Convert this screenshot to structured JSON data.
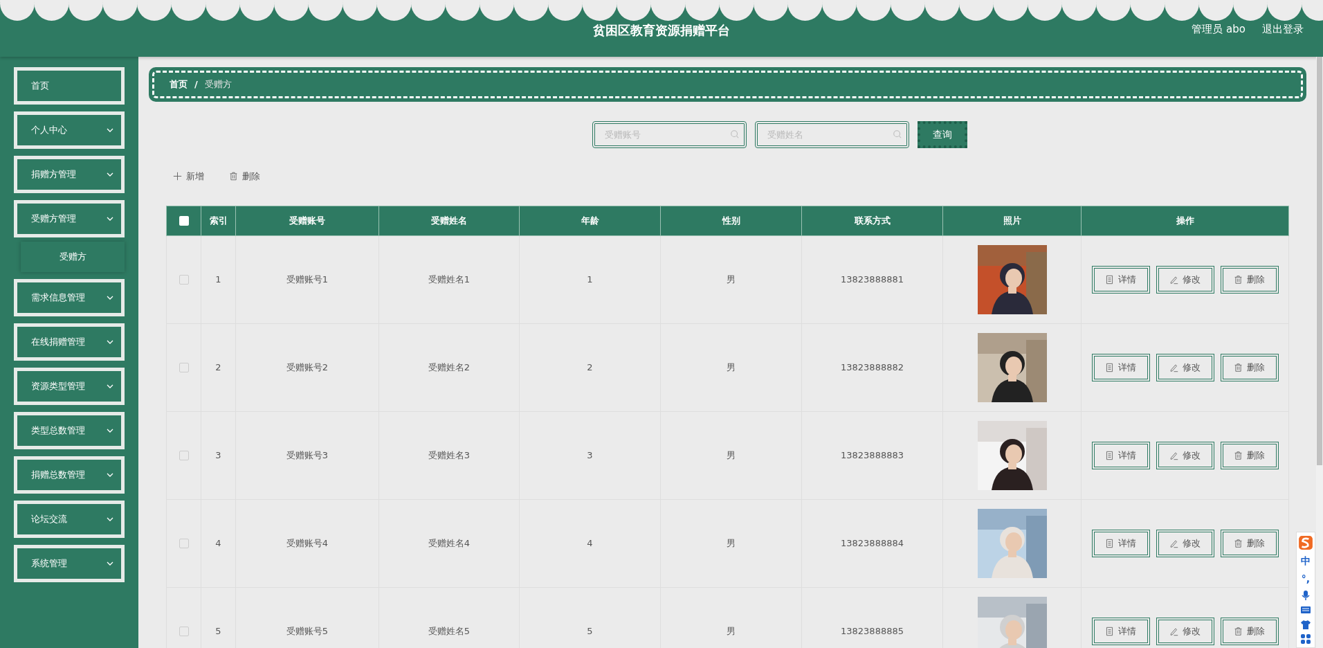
{
  "header": {
    "title": "贫困区教育资源捐赠平台",
    "user": "管理员 abo",
    "logout": "退出登录"
  },
  "sidebar": {
    "items": [
      {
        "label": "首页",
        "kind": "link"
      },
      {
        "label": "个人中心",
        "kind": "menu"
      },
      {
        "label": "捐赠方管理",
        "kind": "menu"
      },
      {
        "label": "受赠方管理",
        "kind": "menu",
        "children": [
          {
            "label": "受赠方"
          }
        ]
      },
      {
        "label": "需求信息管理",
        "kind": "menu"
      },
      {
        "label": "在线捐赠管理",
        "kind": "menu"
      },
      {
        "label": "资源类型管理",
        "kind": "menu"
      },
      {
        "label": "类型总数管理",
        "kind": "menu"
      },
      {
        "label": "捐赠总数管理",
        "kind": "menu"
      },
      {
        "label": "论坛交流",
        "kind": "menu"
      },
      {
        "label": "系统管理",
        "kind": "menu"
      }
    ]
  },
  "breadcrumb_separator": "/",
  "breadcrumb": [
    {
      "label": "首页",
      "current": false
    },
    {
      "label": "受赠方",
      "current": true
    }
  ],
  "search": {
    "fields": [
      {
        "placeholder": "受赠账号"
      },
      {
        "placeholder": "受赠姓名"
      }
    ],
    "button": "查询"
  },
  "toolbar": [
    {
      "label": "新增",
      "kind": "add"
    },
    {
      "label": "删除",
      "kind": "delete"
    }
  ],
  "table": {
    "select_all": {
      "checked": false
    },
    "columns": [
      "索引",
      "受赠账号",
      "受赠姓名",
      "年龄",
      "性别",
      "联系方式",
      "照片",
      "操作"
    ],
    "rows": [
      {
        "checked": false,
        "cells": [
          "1",
          "受赠账号1",
          "受赠姓名1",
          "1",
          "男",
          "13823888881"
        ],
        "actions": [
          {
            "label": "详情",
            "kind": "detail"
          },
          {
            "label": "修改",
            "kind": "edit"
          },
          {
            "label": "删除",
            "kind": "delete"
          }
        ]
      },
      {
        "checked": false,
        "cells": [
          "2",
          "受赠账号2",
          "受赠姓名2",
          "2",
          "男",
          "13823888882"
        ],
        "actions": [
          {
            "label": "详情",
            "kind": "detail"
          },
          {
            "label": "修改",
            "kind": "edit"
          },
          {
            "label": "删除",
            "kind": "delete"
          }
        ]
      },
      {
        "checked": false,
        "cells": [
          "3",
          "受赠账号3",
          "受赠姓名3",
          "3",
          "男",
          "13823888883"
        ],
        "actions": [
          {
            "label": "详情",
            "kind": "detail"
          },
          {
            "label": "修改",
            "kind": "edit"
          },
          {
            "label": "删除",
            "kind": "delete"
          }
        ]
      },
      {
        "checked": false,
        "cells": [
          "4",
          "受赠账号4",
          "受赠姓名4",
          "4",
          "男",
          "13823888884"
        ],
        "actions": [
          {
            "label": "详情",
            "kind": "detail"
          },
          {
            "label": "修改",
            "kind": "edit"
          },
          {
            "label": "删除",
            "kind": "delete"
          }
        ]
      },
      {
        "checked": false,
        "cells": [
          "5",
          "受赠账号5",
          "受赠姓名5",
          "5",
          "男",
          "13823888885"
        ],
        "actions": [
          {
            "label": "详情",
            "kind": "detail"
          },
          {
            "label": "修改",
            "kind": "edit"
          },
          {
            "label": "删除",
            "kind": "delete"
          }
        ]
      }
    ]
  },
  "ime_bar": {
    "mode": "中",
    "punct": "°,"
  }
}
